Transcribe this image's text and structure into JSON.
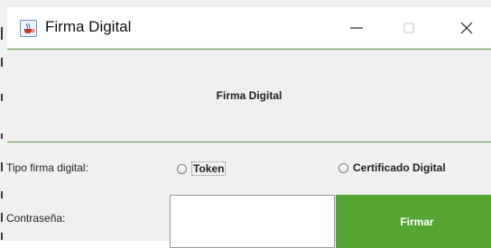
{
  "window": {
    "title": "Firma Digital",
    "icon": "java-cup-icon"
  },
  "titlebar_controls": [
    "minimize-icon",
    "maximize-icon",
    "close-icon"
  ],
  "banner": {
    "title": "Firma Digital"
  },
  "form": {
    "signature_type_label": "Tipo firma digital:",
    "signature_type_options": [
      {
        "label": "Token",
        "selected": false
      },
      {
        "label": "Certificado Digital",
        "selected": false
      }
    ],
    "password_label": "Contraseña:",
    "password_value": "",
    "sign_button_label": "Firmar"
  },
  "colors": {
    "accent_green": "#55a532",
    "banner_border": "#5a9a4a",
    "panel_background": "#f0f0f0"
  }
}
